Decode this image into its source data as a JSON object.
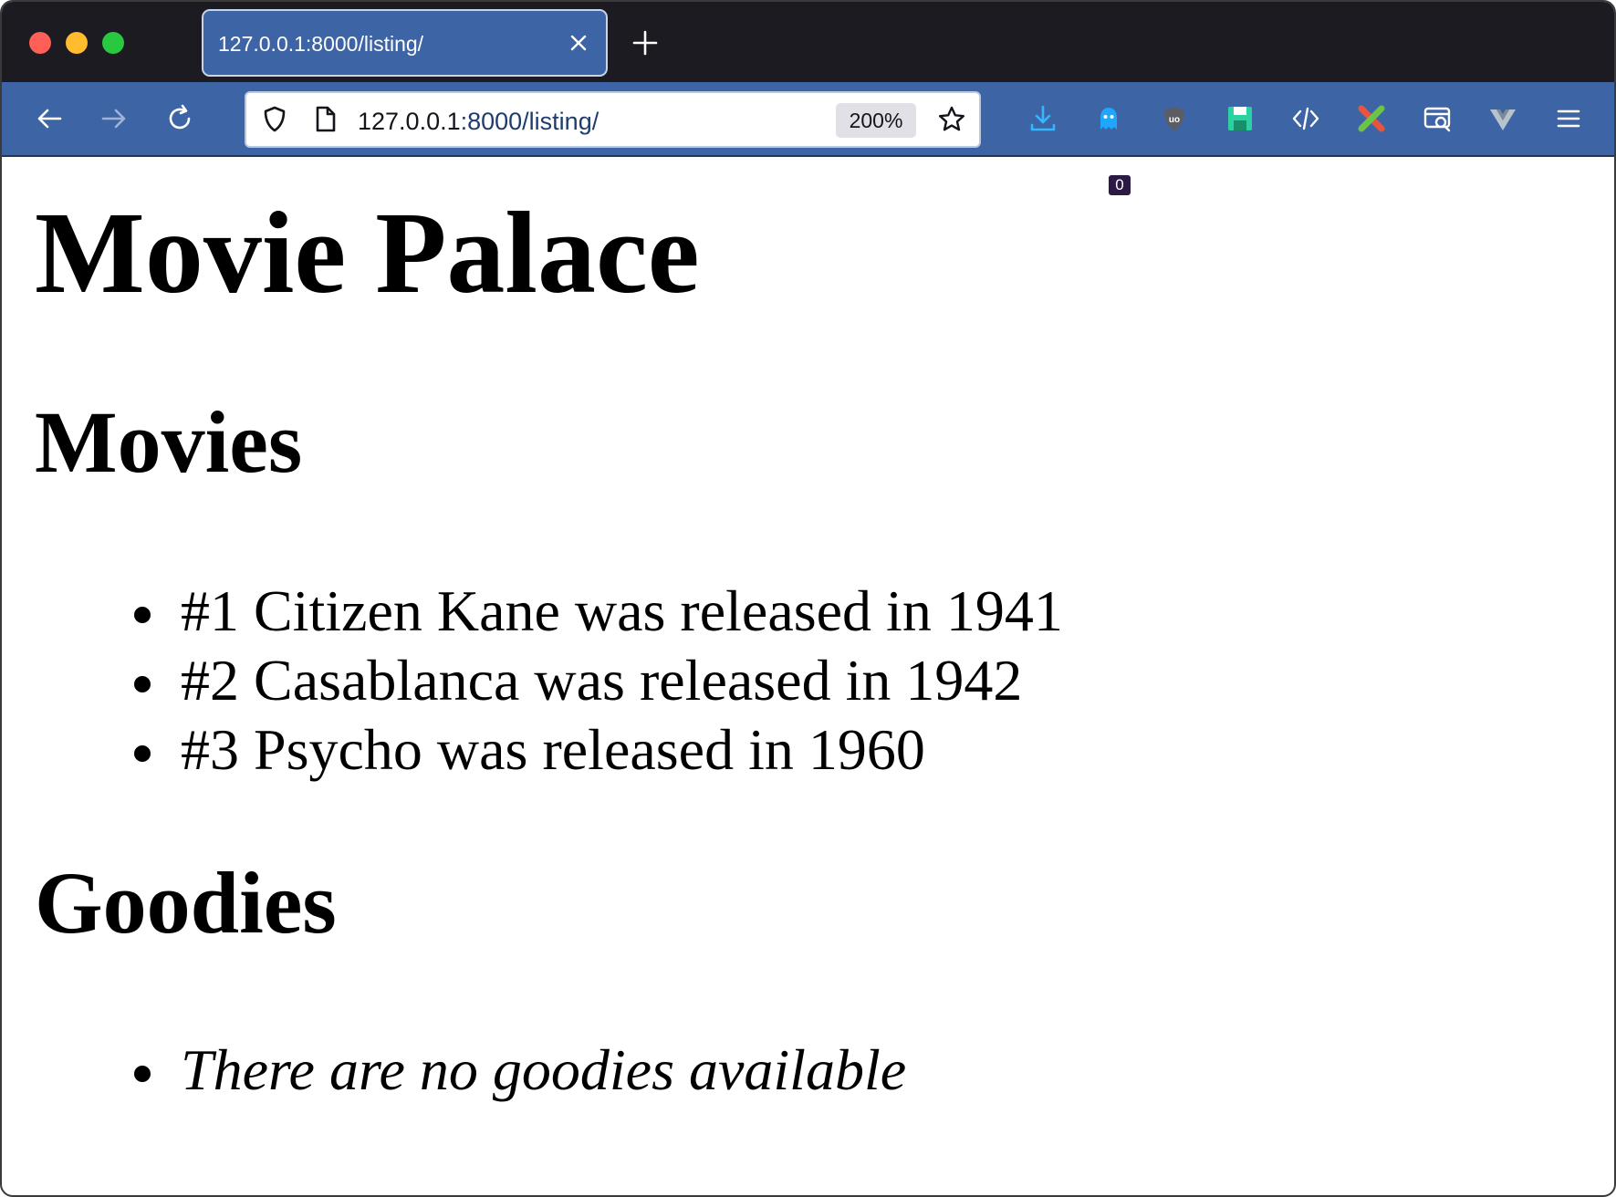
{
  "browser": {
    "tab": {
      "title": "127.0.0.1:8000/listing/"
    },
    "urlbar": {
      "host": "127.0.0.1",
      "path": ":8000/listing/",
      "zoom": "200%"
    },
    "extensions": {
      "ghostery_count": "0"
    },
    "icons": {
      "back": "back-arrow-icon",
      "forward": "forward-arrow-icon",
      "reload": "reload-icon",
      "shield": "tracking-shield-icon",
      "page": "page-icon",
      "bookmark": "bookmark-star-icon",
      "download": "download-icon",
      "ghost": "ghostery-icon",
      "ublock": "ublock-icon",
      "save": "save-icon",
      "devtools": "code-icon",
      "xextension": "x-extension-icon",
      "screenshot": "screenshot-icon",
      "vue": "vue-devtools-icon",
      "menu": "hamburger-menu-icon"
    }
  },
  "page": {
    "title": "Movie Palace",
    "movies": {
      "heading": "Movies",
      "items": [
        "#1 Citizen Kane was released in 1941",
        "#2 Casablanca was released in 1942",
        "#3 Psycho was released in 1960"
      ]
    },
    "goodies": {
      "heading": "Goodies",
      "empty_message": "There are no goodies available"
    }
  }
}
